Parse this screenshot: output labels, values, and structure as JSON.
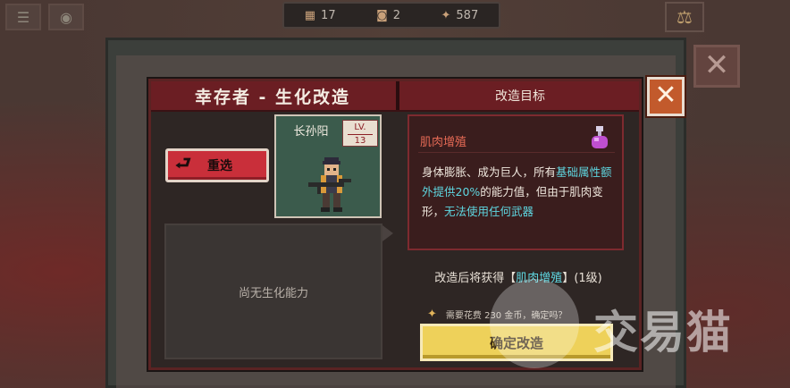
{
  "topbar": {
    "days": "17",
    "food": "2",
    "money": "587"
  },
  "dialog": {
    "title": "幸存者 - 生化改造",
    "right_title": "改造目标",
    "close_label": "✕",
    "reselect_label": "重选",
    "character": {
      "name": "长孙阳",
      "lv_label": "LV.",
      "lv_value": "13"
    },
    "empty_ability": "尚无生化能力",
    "detail": {
      "name": "肌肉增殖",
      "desc_1": "身体膨胀、成为巨人，所有",
      "desc_hl1": "基础属性额外提供20%",
      "desc_2": "的能力值，但由于肌肉变形，",
      "desc_hl2": "无法使用任何武器"
    },
    "result": {
      "prefix": "改造后将获得",
      "bracket_open": "【",
      "skill": "肌肉增殖",
      "bracket_close": "】",
      "level": "(1级)"
    },
    "cost_text": "需要花费 230 金币，确定吗？",
    "confirm_label": "确定改造"
  },
  "watermark": {
    "text": "交易猫"
  },
  "colors": {
    "accent_red": "#6b1e23",
    "highlight_cyan": "#5ed6e0",
    "confirm_yellow": "#eed15a",
    "reselect_red": "#c92f3a"
  },
  "icons": {
    "calendar": "calendar-icon",
    "food": "bread-icon",
    "money": "coin-icon",
    "back": "return-arrow-icon",
    "potion": "potion-icon",
    "close": "close-icon"
  }
}
